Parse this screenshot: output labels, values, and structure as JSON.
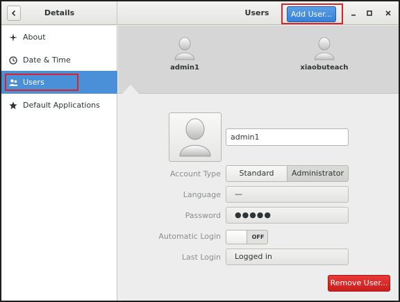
{
  "header": {
    "left_title": "Details",
    "right_title": "Users",
    "add_user_label": "Add User..."
  },
  "sidebar": {
    "items": [
      {
        "label": "About",
        "icon": "star-sparkle-icon"
      },
      {
        "label": "Date & Time",
        "icon": "clock-icon"
      },
      {
        "label": "Users",
        "icon": "users-icon",
        "active": true
      },
      {
        "label": "Default Applications",
        "icon": "star-icon"
      }
    ]
  },
  "user_strip": {
    "users": [
      {
        "name": "admin1",
        "selected": true
      },
      {
        "name": "xiaobuteach"
      }
    ]
  },
  "form": {
    "name_value": "admin1",
    "account_type": {
      "label": "Account Type",
      "options": [
        "Standard",
        "Administrator"
      ],
      "selected": "Administrator"
    },
    "language": {
      "label": "Language",
      "value": "—"
    },
    "password": {
      "label": "Password",
      "value": "●●●●●"
    },
    "automatic_login": {
      "label": "Automatic Login",
      "state": "OFF"
    },
    "last_login": {
      "label": "Last Login",
      "value": "Logged in"
    },
    "remove_label": "Remove User..."
  },
  "colors": {
    "accent": "#4a90d9",
    "suggested_action": "#3580d8",
    "destructive_action": "#cc1d1d",
    "highlight_box": "#d8232a"
  }
}
